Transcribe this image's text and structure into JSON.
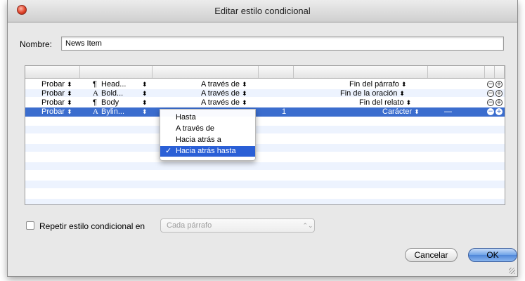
{
  "window": {
    "title": "Editar estilo condicional"
  },
  "name": {
    "label": "Nombre:",
    "value": "News Item"
  },
  "rows": [
    {
      "test": "Probar",
      "style_icon": "pilcrow-icon",
      "style": "Head...",
      "relation": "A través de",
      "count": "",
      "unit": "Fin del párrafo",
      "extra": ""
    },
    {
      "test": "Probar",
      "style_icon": "character-style-icon",
      "style": "Bold...",
      "relation": "A través de",
      "count": "",
      "unit": "Fin de la oración",
      "extra": ""
    },
    {
      "test": "Probar",
      "style_icon": "pilcrow-icon",
      "style": "Body",
      "relation": "A través de",
      "count": "",
      "unit": "Fin del relato",
      "extra": ""
    },
    {
      "test": "Probar",
      "style_icon": "character-style-icon",
      "style": "Bylin...",
      "relation": "Hacia atrás hasta",
      "count": "1",
      "unit": "Carácter",
      "extra": "—"
    }
  ],
  "glyphs": {
    "pilcrow": "¶",
    "char_style": "A",
    "updown": "⬍",
    "minus": "−",
    "plus": "+",
    "check": "✓",
    "stepper": "⌃⌄"
  },
  "menu": {
    "items": [
      "Hasta",
      "A través de",
      "Hacia atrás a",
      "Hacia atrás hasta"
    ],
    "selected": "Hacia atrás hasta"
  },
  "repeat": {
    "label": "Repetir estilo condicional en",
    "checked": false,
    "value": "Cada párrafo",
    "enabled": false
  },
  "buttons": {
    "cancel": "Cancelar",
    "ok": "OK"
  },
  "colors": {
    "selection": "#3b6dce",
    "menu_highlight": "#2a5fd6",
    "close_button": "#e0442b"
  }
}
